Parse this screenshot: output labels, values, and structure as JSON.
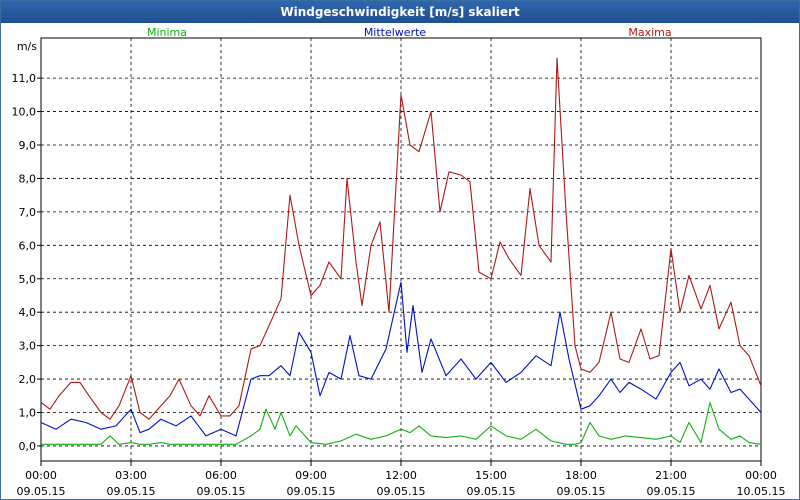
{
  "window": {
    "title": "Windgeschwindigkeit [m/s] skaliert"
  },
  "chart_data": {
    "type": "line",
    "title": "Windgeschwindigkeit [m/s] skaliert",
    "ylabel": "m/s",
    "ylim": [
      -0.45,
      12.2
    ],
    "xlim": [
      0,
      24
    ],
    "grid": true,
    "legend_placement": "top",
    "yticks": [
      {
        "value": 0,
        "label": "0,0"
      },
      {
        "value": 1,
        "label": "1,0"
      },
      {
        "value": 2,
        "label": "2,0"
      },
      {
        "value": 3,
        "label": "3,0"
      },
      {
        "value": 4,
        "label": "4,0"
      },
      {
        "value": 5,
        "label": "5,0"
      },
      {
        "value": 6,
        "label": "6,0"
      },
      {
        "value": 7,
        "label": "7,0"
      },
      {
        "value": 8,
        "label": "8,0"
      },
      {
        "value": 9,
        "label": "9,0"
      },
      {
        "value": 10,
        "label": "10,0"
      },
      {
        "value": 11,
        "label": "11,0"
      }
    ],
    "xticks": [
      {
        "value": 0,
        "time": "00:00",
        "date": "09.05.15"
      },
      {
        "value": 3,
        "time": "03:00",
        "date": "09.05.15"
      },
      {
        "value": 6,
        "time": "06:00",
        "date": "09.05.15"
      },
      {
        "value": 9,
        "time": "09:00",
        "date": "09.05.15"
      },
      {
        "value": 12,
        "time": "12:00",
        "date": "09.05.15"
      },
      {
        "value": 15,
        "time": "15:00",
        "date": "09.05.15"
      },
      {
        "value": 18,
        "time": "18:00",
        "date": "09.05.15"
      },
      {
        "value": 21,
        "time": "21:00",
        "date": "09.05.15"
      },
      {
        "value": 24,
        "time": "00:00",
        "date": "10.05.15"
      }
    ],
    "series": [
      {
        "name": "Minima",
        "color": "#10b010",
        "x": [
          0,
          0.5,
          1,
          1.5,
          2,
          2.3,
          2.6,
          3,
          3.3,
          3.6,
          4,
          4.3,
          4.6,
          5,
          5.5,
          6,
          6.5,
          6.8,
          7,
          7.3,
          7.5,
          7.8,
          8,
          8.3,
          8.5,
          8.8,
          9,
          9.5,
          10,
          10.5,
          11,
          11.5,
          12,
          12.3,
          12.6,
          13,
          13.5,
          14,
          14.5,
          15,
          15.5,
          16,
          16.5,
          17,
          17.5,
          17.8,
          18,
          18.3,
          18.6,
          19,
          19.5,
          20,
          20.5,
          21,
          21.3,
          21.6,
          22,
          22.3,
          22.6,
          23,
          23.3,
          23.6,
          24
        ],
        "y": [
          0.05,
          0.05,
          0.05,
          0.05,
          0.05,
          0.3,
          0.05,
          0.1,
          0.05,
          0.05,
          0.1,
          0.05,
          0.05,
          0.05,
          0.05,
          0.05,
          0.05,
          0.2,
          0.3,
          0.5,
          1.1,
          0.5,
          1.0,
          0.3,
          0.6,
          0.3,
          0.1,
          0.05,
          0.15,
          0.35,
          0.2,
          0.3,
          0.5,
          0.4,
          0.6,
          0.3,
          0.25,
          0.3,
          0.2,
          0.6,
          0.3,
          0.2,
          0.5,
          0.15,
          0.05,
          0.05,
          0.1,
          0.7,
          0.3,
          0.2,
          0.3,
          0.25,
          0.2,
          0.3,
          0.1,
          0.7,
          0.1,
          1.3,
          0.5,
          0.2,
          0.3,
          0.1,
          0.05
        ]
      },
      {
        "name": "Mittelwerte",
        "color": "#0010c8",
        "x": [
          0,
          0.5,
          1,
          1.5,
          2,
          2.5,
          3,
          3.3,
          3.6,
          4,
          4.5,
          5,
          5.5,
          6,
          6.5,
          7,
          7.3,
          7.6,
          8,
          8.3,
          8.6,
          9,
          9.3,
          9.6,
          10,
          10.3,
          10.6,
          11,
          11.5,
          12,
          12.2,
          12.4,
          12.7,
          13,
          13.5,
          14,
          14.5,
          15,
          15.5,
          16,
          16.5,
          17,
          17.3,
          17.6,
          18,
          18.3,
          18.6,
          19,
          19.3,
          19.6,
          20,
          20.5,
          21,
          21.3,
          21.6,
          22,
          22.3,
          22.6,
          23,
          23.3,
          23.6,
          24
        ],
        "y": [
          0.7,
          0.5,
          0.8,
          0.7,
          0.5,
          0.6,
          1.1,
          0.4,
          0.5,
          0.8,
          0.6,
          0.9,
          0.3,
          0.5,
          0.3,
          2.0,
          2.1,
          2.1,
          2.4,
          2.1,
          3.4,
          2.8,
          1.5,
          2.2,
          2.0,
          3.3,
          2.1,
          2.0,
          2.9,
          4.9,
          2.8,
          4.2,
          2.2,
          3.2,
          2.1,
          2.6,
          2.0,
          2.5,
          1.9,
          2.2,
          2.7,
          2.4,
          4.0,
          2.6,
          1.1,
          1.2,
          1.5,
          2.0,
          1.6,
          1.9,
          1.7,
          1.4,
          2.2,
          2.5,
          1.8,
          2.0,
          1.7,
          2.3,
          1.6,
          1.7,
          1.4,
          1.0
        ]
      },
      {
        "name": "Maxima",
        "color": "#b01818",
        "x": [
          0,
          0.3,
          0.6,
          1,
          1.3,
          1.6,
          2,
          2.3,
          2.6,
          3,
          3.3,
          3.6,
          4,
          4.3,
          4.6,
          5,
          5.3,
          5.6,
          6,
          6.3,
          6.6,
          7,
          7.3,
          7.6,
          8,
          8.3,
          8.6,
          9,
          9.3,
          9.6,
          10,
          10.2,
          10.5,
          10.7,
          11,
          11.3,
          11.6,
          12,
          12.3,
          12.6,
          13,
          13.3,
          13.6,
          14,
          14.3,
          14.6,
          15,
          15.3,
          15.6,
          16,
          16.3,
          16.6,
          17,
          17.2,
          17.5,
          17.8,
          18,
          18.3,
          18.6,
          19,
          19.3,
          19.6,
          20,
          20.3,
          20.6,
          21,
          21.3,
          21.6,
          22,
          22.3,
          22.6,
          23,
          23.3,
          23.6,
          24
        ],
        "y": [
          1.3,
          1.1,
          1.5,
          1.9,
          1.9,
          1.5,
          1.0,
          0.8,
          1.2,
          2.1,
          1.0,
          0.8,
          1.2,
          1.5,
          2.0,
          1.2,
          0.9,
          1.5,
          0.9,
          0.9,
          1.2,
          2.9,
          3.0,
          3.6,
          4.4,
          7.5,
          6.0,
          4.5,
          4.8,
          5.5,
          5.0,
          8.0,
          5.5,
          4.2,
          6.0,
          6.7,
          4.0,
          10.5,
          9.0,
          8.8,
          10.0,
          7.0,
          8.2,
          8.1,
          7.9,
          5.2,
          5.0,
          6.1,
          5.6,
          5.1,
          7.7,
          6.0,
          5.5,
          11.6,
          7.0,
          3.0,
          2.3,
          2.2,
          2.5,
          4.0,
          2.6,
          2.5,
          3.5,
          2.6,
          2.7,
          5.9,
          4.0,
          5.1,
          4.1,
          4.8,
          3.5,
          4.3,
          3.0,
          2.7,
          1.8
        ]
      }
    ]
  }
}
